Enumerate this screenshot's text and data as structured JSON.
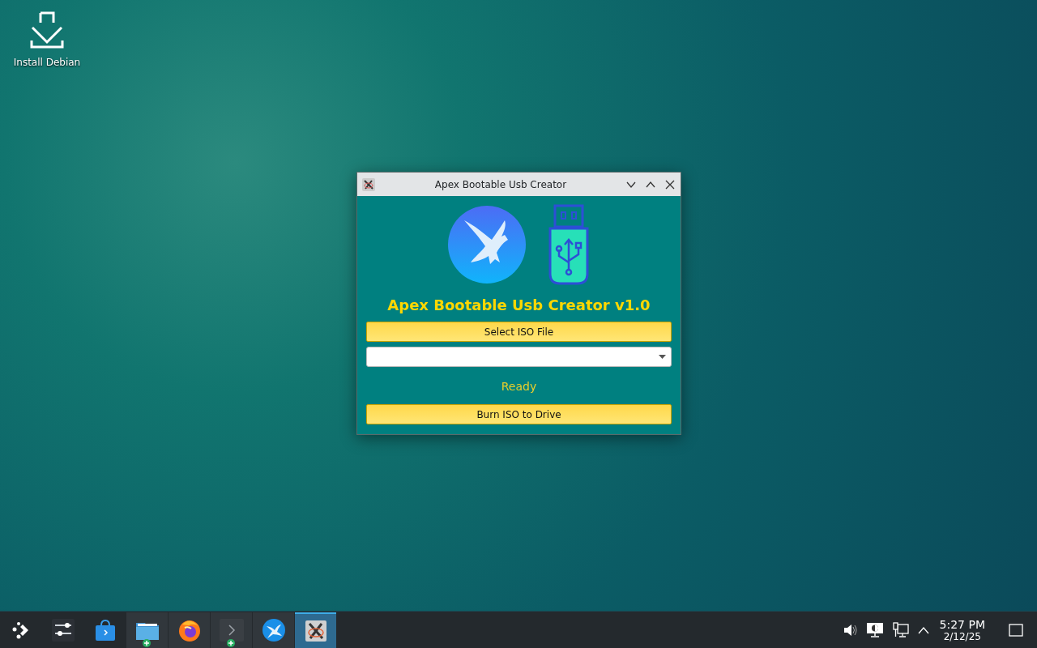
{
  "desktop_icons": [
    {
      "label": "Install Debian"
    }
  ],
  "window": {
    "title": "Apex Bootable Usb Creator",
    "heading": "Apex Bootable Usb Creator v1.0",
    "select_button": "Select ISO File",
    "status": "Ready",
    "burn_button": "Burn ISO to Drive"
  },
  "taskbar": {
    "items": [
      {
        "kind": "launcher",
        "running": false,
        "selected": false,
        "new": false
      },
      {
        "kind": "settings",
        "running": false,
        "selected": false,
        "new": false
      },
      {
        "kind": "store",
        "running": false,
        "selected": false,
        "new": false
      },
      {
        "kind": "folder",
        "running": true,
        "selected": false,
        "new": true
      },
      {
        "kind": "browser",
        "running": true,
        "selected": false,
        "new": false
      },
      {
        "kind": "terminal",
        "running": true,
        "selected": false,
        "new": true
      },
      {
        "kind": "bird",
        "running": true,
        "selected": false,
        "new": false
      },
      {
        "kind": "xapp",
        "running": true,
        "selected": true,
        "new": false
      }
    ],
    "tray": [
      {
        "kind": "volume"
      },
      {
        "kind": "display"
      },
      {
        "kind": "network"
      },
      {
        "kind": "caret"
      }
    ],
    "clock": {
      "time": "5:27 PM",
      "date": "2/12/25"
    }
  }
}
